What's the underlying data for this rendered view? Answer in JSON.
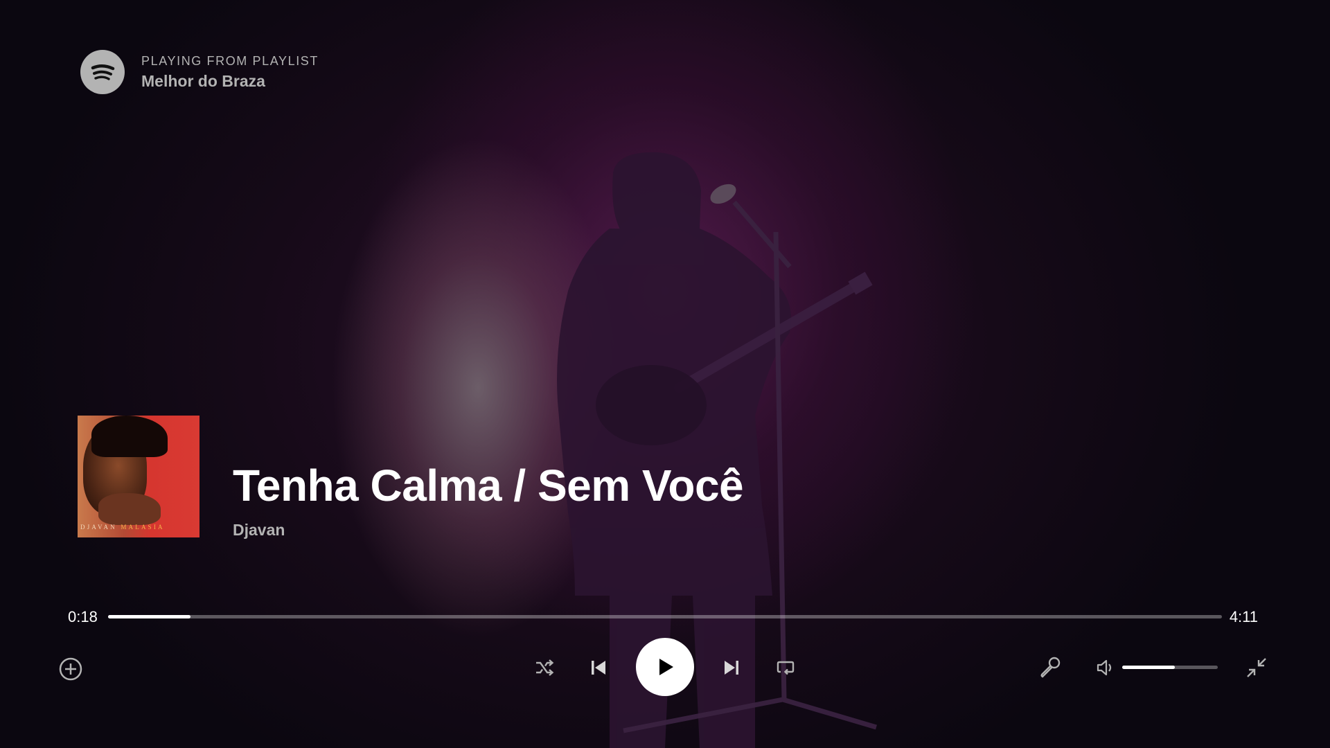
{
  "colors": {
    "accent": "#ffffff",
    "secondary_text": "#b3b3b3",
    "background": "#160a18"
  },
  "header": {
    "context_label": "PLAYING FROM PLAYLIST",
    "context_name": "Melhor do Braza",
    "logo_icon": "spotify-logo-icon"
  },
  "now_playing": {
    "cover_text_primary": "DJAVAN",
    "cover_text_secondary": "MALASIA",
    "title": "Tenha Calma / Sem Você",
    "artist": "Djavan"
  },
  "playback": {
    "elapsed": "0:18",
    "total": "4:11",
    "progress_fraction": 0.074
  },
  "controls": {
    "add_icon": "plus-circle-icon",
    "shuffle_icon": "shuffle-icon",
    "prev_icon": "skip-previous-icon",
    "play_icon": "play-icon",
    "next_icon": "skip-next-icon",
    "repeat_icon": "repeat-icon",
    "lyrics_icon": "microphone-icon",
    "volume_icon": "volume-icon",
    "minimize_icon": "minimize-icon"
  },
  "volume": {
    "level_fraction": 0.55
  }
}
